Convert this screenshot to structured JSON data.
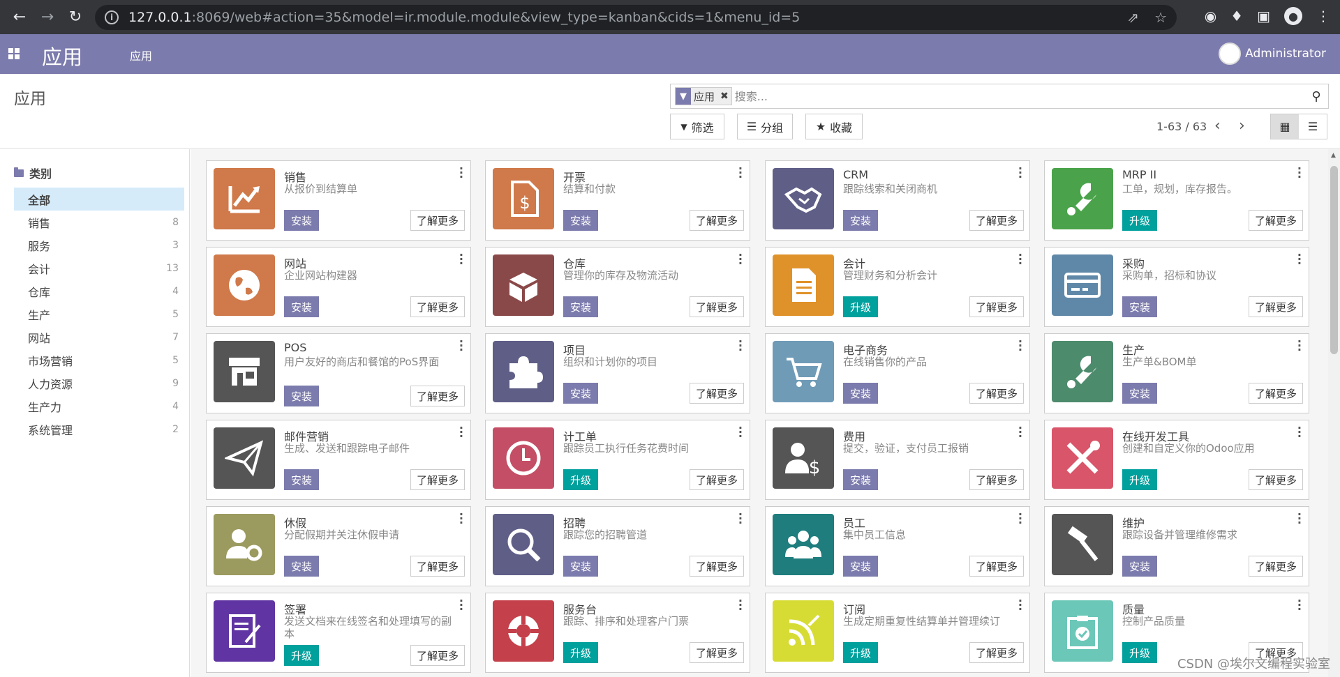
{
  "browser": {
    "url_host": "127.0.0.1",
    "url_rest": ":8069/web#action=35&model=ir.module.module&view_type=kanban&cids=1&menu_id=5"
  },
  "navbar": {
    "brand": "应用",
    "menu_item": "应用",
    "user_name": "Administrator"
  },
  "control": {
    "title": "应用",
    "facet_label": "应用",
    "search_placeholder": "搜索...",
    "filter_label": "筛选",
    "group_label": "分组",
    "favorite_label": "收藏",
    "pager": "1-63 / 63"
  },
  "sidebar": {
    "header": "类别",
    "items": [
      {
        "label": "全部",
        "count": ""
      },
      {
        "label": "销售",
        "count": "8"
      },
      {
        "label": "服务",
        "count": "3"
      },
      {
        "label": "会计",
        "count": "13"
      },
      {
        "label": "仓库",
        "count": "4"
      },
      {
        "label": "生产",
        "count": "5"
      },
      {
        "label": "网站",
        "count": "7"
      },
      {
        "label": "市场营销",
        "count": "5"
      },
      {
        "label": "人力资源",
        "count": "9"
      },
      {
        "label": "生产力",
        "count": "4"
      },
      {
        "label": "系统管理",
        "count": "2"
      }
    ]
  },
  "labels": {
    "install": "安装",
    "upgrade": "升级",
    "learn_more": "了解更多"
  },
  "apps": [
    {
      "name": "销售",
      "desc": "从报价到结算单",
      "action": "install",
      "color": "#d0794a",
      "icon": "chart-line-icon"
    },
    {
      "name": "开票",
      "desc": "结算和付款",
      "action": "install",
      "color": "#d0794a",
      "icon": "invoice-icon"
    },
    {
      "name": "CRM",
      "desc": "跟踪线索和关闭商机",
      "action": "install",
      "color": "#5f5e87",
      "icon": "handshake-icon"
    },
    {
      "name": "MRP II",
      "desc": "工单，规划，库存报告。",
      "action": "upgrade",
      "color": "#4aa34a",
      "icon": "wrench-icon"
    },
    {
      "name": "网站",
      "desc": "企业网站构建器",
      "action": "install",
      "color": "#d0794a",
      "icon": "globe-icon"
    },
    {
      "name": "仓库",
      "desc": "管理你的库存及物流活动",
      "action": "install",
      "color": "#8a4949",
      "icon": "box-icon"
    },
    {
      "name": "会计",
      "desc": "管理财务和分析会计",
      "action": "upgrade",
      "color": "#e0922a",
      "icon": "document-icon"
    },
    {
      "name": "采购",
      "desc": "采购单，招标和协议",
      "action": "install",
      "color": "#5f88a8",
      "icon": "credit-card-icon"
    },
    {
      "name": "POS",
      "desc": "用户友好的商店和餐馆的PoS界面",
      "action": "install",
      "color": "#555555",
      "icon": "store-icon"
    },
    {
      "name": "项目",
      "desc": "组织和计划你的项目",
      "action": "install",
      "color": "#5f5e87",
      "icon": "puzzle-icon"
    },
    {
      "name": "电子商务",
      "desc": "在线销售你的产品",
      "action": "install",
      "color": "#6f9bb7",
      "icon": "cart-icon"
    },
    {
      "name": "生产",
      "desc": "生产单&BOM单",
      "action": "install",
      "color": "#4d8b6d",
      "icon": "wrench-icon"
    },
    {
      "name": "邮件营销",
      "desc": "生成、发送和跟踪电子邮件",
      "action": "install",
      "color": "#555555",
      "icon": "paper-plane-icon"
    },
    {
      "name": "计工单",
      "desc": "跟踪员工执行任务花费时间",
      "action": "upgrade",
      "color": "#c44e65",
      "icon": "clock-icon"
    },
    {
      "name": "费用",
      "desc": "提交，验证，支付员工报销",
      "action": "install",
      "color": "#555555",
      "icon": "user-dollar-icon"
    },
    {
      "name": "在线开发工具",
      "desc": "创建和自定义你的Odoo应用",
      "action": "upgrade",
      "color": "#d9556a",
      "icon": "tools-icon"
    },
    {
      "name": "休假",
      "desc": "分配假期并关注休假申请",
      "action": "install",
      "color": "#9b9a5f",
      "icon": "user-gear-icon"
    },
    {
      "name": "招聘",
      "desc": "跟踪您的招聘管道",
      "action": "install",
      "color": "#5f5e87",
      "icon": "magnifier-icon"
    },
    {
      "name": "员工",
      "desc": "集中员工信息",
      "action": "install",
      "color": "#1f7d7d",
      "icon": "users-icon"
    },
    {
      "name": "维护",
      "desc": "跟踪设备并管理维修需求",
      "action": "install",
      "color": "#555555",
      "icon": "hammer-icon"
    },
    {
      "name": "签署",
      "desc": "发送文档来在线签名和处理填写的副本",
      "action": "upgrade",
      "color": "#6035a3",
      "icon": "sign-document-icon"
    },
    {
      "name": "服务台",
      "desc": "跟踪、排序和处理客户门票",
      "action": "upgrade",
      "color": "#c4404a",
      "icon": "lifebuoy-icon"
    },
    {
      "name": "订阅",
      "desc": "生成定期重复性结算单并管理续订",
      "action": "upgrade",
      "color": "#d7dc35",
      "icon": "rss-icon"
    },
    {
      "name": "质量",
      "desc": "控制产品质量",
      "action": "upgrade",
      "color": "#6bc7b8",
      "icon": "quality-clipboard-icon"
    }
  ],
  "watermark": "CSDN @埃尔文编程实验室"
}
